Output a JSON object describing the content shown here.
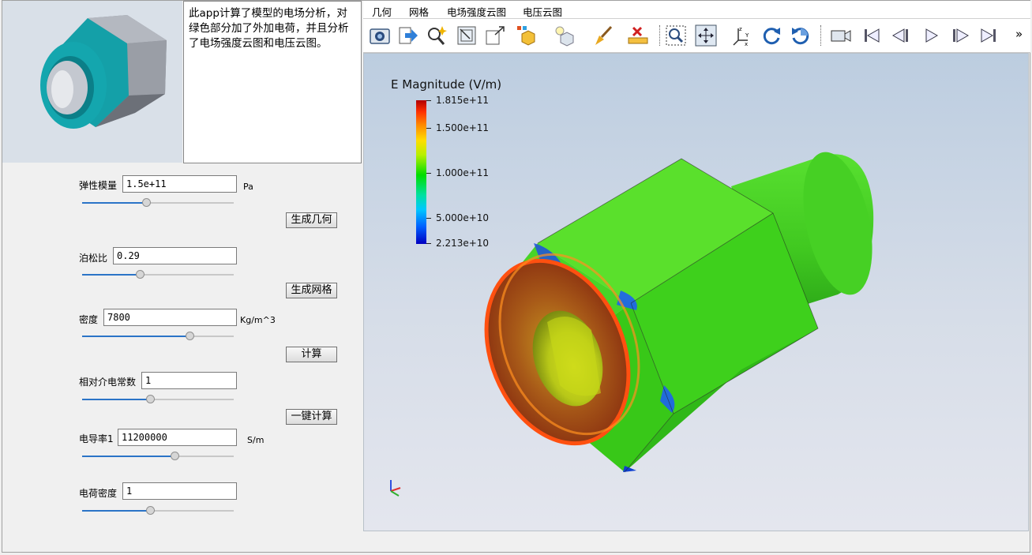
{
  "description": "此app计算了模型的电场分析，对绿色部分加了外加电荷，并且分析了电场强度云图和电压云图。",
  "params": [
    {
      "label": "弹性模量",
      "value": "1.5e+11",
      "unit": "Pa",
      "slider": 0.42
    },
    {
      "label": "泊松比",
      "value": "0.29",
      "unit": "",
      "slider": 0.38
    },
    {
      "label": "密度",
      "value": "7800",
      "unit": "Kg/m^3",
      "slider": 0.71
    },
    {
      "label": "相对介电常数",
      "value": "1",
      "unit": "",
      "slider": 0.45
    },
    {
      "label": "电导率1",
      "value": "11200000",
      "unit": "S/m",
      "slider": 0.61
    },
    {
      "label": "电荷密度",
      "value": "1",
      "unit": "",
      "slider": 0.45
    }
  ],
  "buttons": {
    "geometry": "生成几何",
    "mesh": "生成网格",
    "compute": "计算",
    "one_click": "一键计算"
  },
  "tabs": [
    "几何",
    "网格",
    "电场强度云图",
    "电压云图"
  ],
  "toolbar": {
    "icons": [
      "camera-icon",
      "export-icon",
      "zoom-magic-icon",
      "zoom-box-icon",
      "maximize-icon",
      "color-cube-icon",
      "light-cube-icon",
      "brush-icon",
      "ruler-clear-icon",
      "zoom-select-icon",
      "pan-icon",
      "axes-icon",
      "rotate-cw-icon",
      "rotate-ccw-icon",
      "video-camera-icon",
      "first-frame-icon",
      "prev-frame-icon",
      "play-icon",
      "next-frame-icon",
      "last-frame-icon"
    ],
    "overflow": "»"
  },
  "legend": {
    "title": "E Magnitude (V/m)",
    "labels": [
      "1.815e+11",
      "1.500e+11",
      "1.000e+11",
      "5.000e+10",
      "2.213e+10"
    ],
    "colors": {
      "high": "#b00000",
      "mid": "#00dd00",
      "low": "#0000c0"
    }
  },
  "axes_labels": {
    "y": "y",
    "x": "x",
    "z": "z"
  }
}
